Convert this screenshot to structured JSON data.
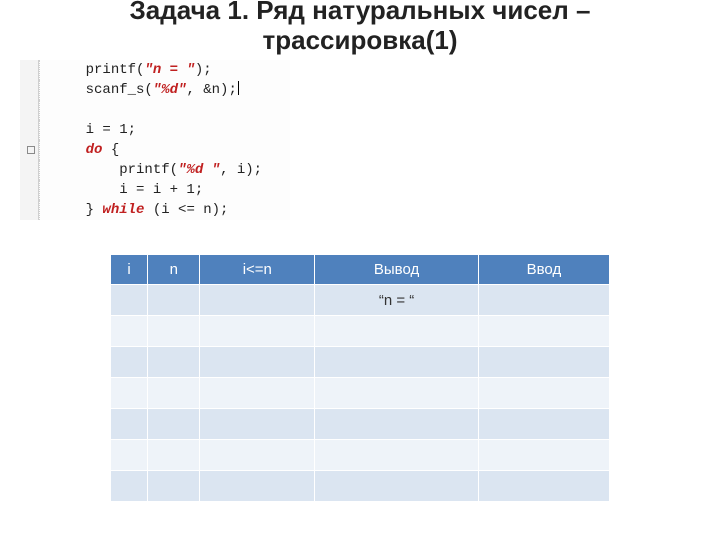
{
  "title": "Задача 1. Ряд натуральных чисел – трассировка(1)",
  "code": {
    "lines": [
      {
        "plain": "printf",
        "str": "\"n = \"",
        "tail": ";"
      },
      {
        "plain": "scanf_s",
        "str": "\"%d\"",
        "tail": "&n);"
      },
      {
        "plain": ""
      },
      {
        "plain": "i = 1;"
      },
      {
        "kw": "do",
        "tail": "{"
      },
      {
        "plain": "printf",
        "str": "\"%d \"",
        "tail": "i);"
      },
      {
        "plain": "i = i + 1;"
      },
      {
        "plain": "}",
        "kw": "while",
        "tail": "(i <= n);"
      }
    ]
  },
  "table": {
    "headers": [
      "i",
      "n",
      "i<=n",
      "Вывод",
      "Ввод"
    ],
    "rows": [
      [
        "",
        "",
        "",
        "“n = “",
        ""
      ],
      [
        "",
        "",
        "",
        "",
        ""
      ],
      [
        "",
        "",
        "",
        "",
        ""
      ],
      [
        "",
        "",
        "",
        "",
        ""
      ],
      [
        "",
        "",
        "",
        "",
        ""
      ],
      [
        "",
        "",
        "",
        "",
        ""
      ],
      [
        "",
        "",
        "",
        "",
        ""
      ]
    ]
  }
}
